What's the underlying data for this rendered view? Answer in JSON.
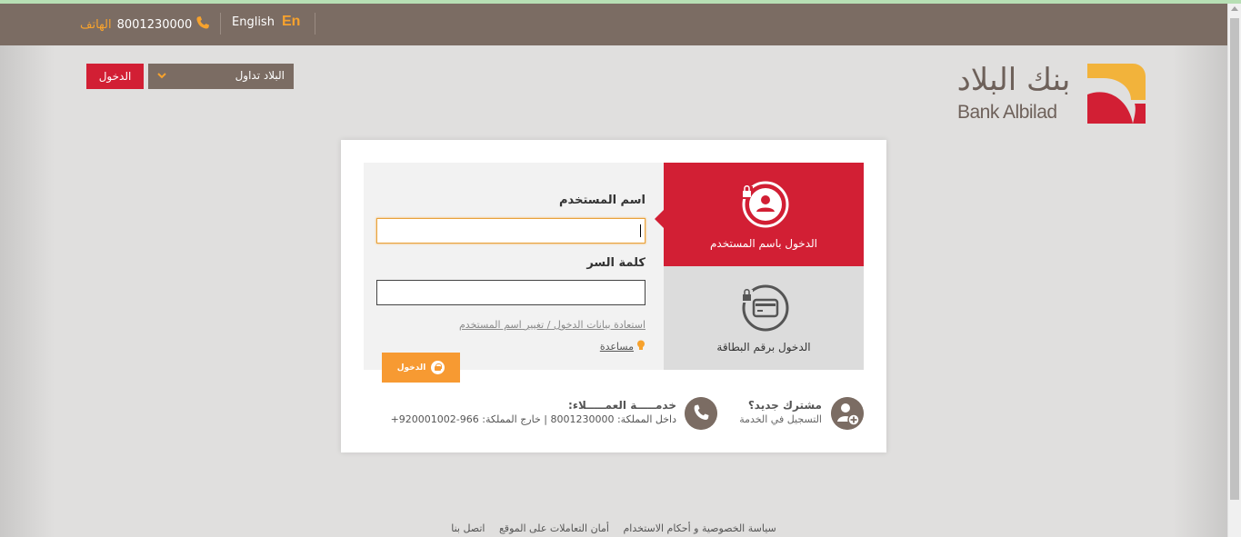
{
  "topbar": {
    "phone_number": "8001230000",
    "phone_label": "الهاتف",
    "language_label": "English",
    "language_code": "En"
  },
  "header": {
    "login_button": "الدخول",
    "service_select": "البلاد تداول",
    "logo_arabic": "بنك البلاد",
    "logo_english": "Bank Albilad"
  },
  "login": {
    "tabs": [
      {
        "label": "الدخول باسم المستخدم",
        "active": true
      },
      {
        "label": "الدخول برقم البطاقة",
        "active": false
      }
    ],
    "username_label": "اسم المستخدم",
    "username_value": "",
    "password_label": "كلمة السر",
    "password_value": "",
    "recover_link": "استعادة بيانات الدخول / تغيير اسم المستخدم",
    "help_link": "مساعدة",
    "submit_label": "الدخول"
  },
  "info": {
    "register_title": "مشترك جديد؟",
    "register_subtitle": "التسجيل في الخدمة",
    "service_title": "خدمـــــة العمـــــلاء:",
    "service_details": "داخل المملكة: 8001230000   |   خارج المملكة: 966-920001002+"
  },
  "footer": {
    "links": [
      "سياسة الخصوصية و أحكام الاستخدام",
      "أمان التعاملات على الموقع",
      "اتصل بنا"
    ]
  },
  "colors": {
    "brand_red": "#d21f34",
    "brand_brown": "#7b6c63",
    "accent_orange": "#f79a32"
  }
}
